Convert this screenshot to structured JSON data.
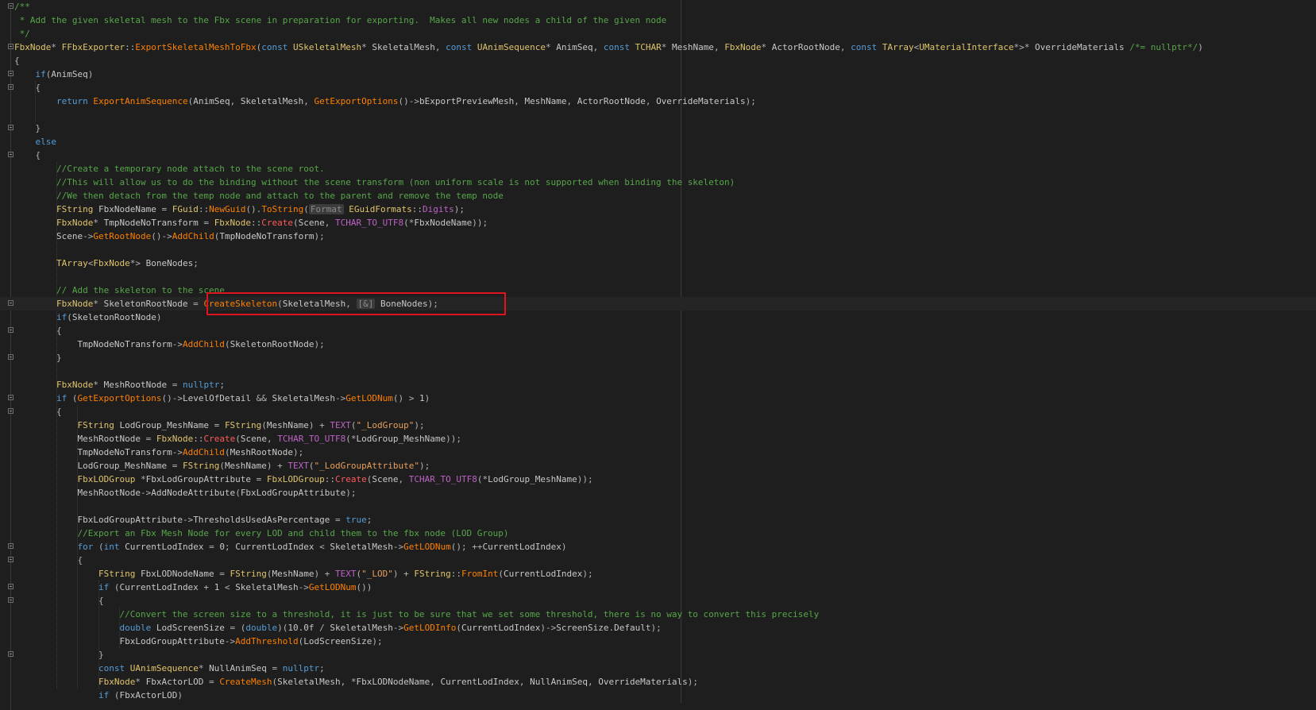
{
  "editor": {
    "lines": [
      "/**",
      " * Add the given skeletal mesh to the Fbx scene in preparation for exporting.  Makes all new nodes a child of the given node",
      " */",
      "FbxNode* FFbxExporter::ExportSkeletalMeshToFbx(const USkeletalMesh* SkeletalMesh, const UAnimSequence* AnimSeq, const TCHAR* MeshName, FbxNode* ActorRootNode, const TArray<UMaterialInterface*>* OverrideMaterials /*= nullptr*/)",
      "{",
      "    if(AnimSeq)",
      "    {",
      "        return ExportAnimSequence(AnimSeq, SkeletalMesh, GetExportOptions()->bExportPreviewMesh, MeshName, ActorRootNode, OverrideMaterials);",
      "",
      "    }",
      "    else",
      "    {",
      "        //Create a temporary node attach to the scene root.",
      "        //This will allow us to do the binding without the scene transform (non uniform scale is not supported when binding the skeleton)",
      "        //We then detach from the temp node and attach to the parent and remove the temp node",
      "        FString FbxNodeName = FGuid::NewGuid().ToString(Format EGuidFormats::Digits);",
      "        FbxNode* TmpNodeNoTransform = FbxNode::Create(Scene, TCHAR_TO_UTF8(*FbxNodeName));",
      "        Scene->GetRootNode()->AddChild(TmpNodeNoTransform);",
      "",
      "        TArray<FbxNode*> BoneNodes;",
      "",
      "        // Add the skeleton to the scene",
      "        FbxNode* SkeletonRootNode = CreateSkeleton(SkeletalMesh, [&] BoneNodes);",
      "        if(SkeletonRootNode)",
      "        {",
      "            TmpNodeNoTransform->AddChild(SkeletonRootNode);",
      "        }",
      "",
      "        FbxNode* MeshRootNode = nullptr;",
      "        if (GetExportOptions()->LevelOfDetail && SkeletalMesh->GetLODNum() > 1)",
      "        {",
      "            FString LodGroup_MeshName = FString(MeshName) + TEXT(\"_LodGroup\");",
      "            MeshRootNode = FbxNode::Create(Scene, TCHAR_TO_UTF8(*LodGroup_MeshName));",
      "            TmpNodeNoTransform->AddChild(MeshRootNode);",
      "            LodGroup_MeshName = FString(MeshName) + TEXT(\"_LodGroupAttribute\");",
      "            FbxLODGroup *FbxLodGroupAttribute = FbxLODGroup::Create(Scene, TCHAR_TO_UTF8(*LodGroup_MeshName));",
      "            MeshRootNode->AddNodeAttribute(FbxLodGroupAttribute);",
      "",
      "            FbxLodGroupAttribute->ThresholdsUsedAsPercentage = true;",
      "            //Export an Fbx Mesh Node for every LOD and child them to the fbx node (LOD Group)",
      "            for (int CurrentLodIndex = 0; CurrentLodIndex < SkeletalMesh->GetLODNum(); ++CurrentLodIndex)",
      "            {",
      "                FString FbxLODNodeName = FString(MeshName) + TEXT(\"_LOD\") + FString::FromInt(CurrentLodIndex);",
      "                if (CurrentLodIndex + 1 < SkeletalMesh->GetLODNum())",
      "                {",
      "                    //Convert the screen size to a threshold, it is just to be sure that we set some threshold, there is no way to convert this precisely",
      "                    double LodScreenSize = (double)(10.0f / SkeletalMesh->GetLODInfo(CurrentLodIndex)->ScreenSize.Default);",
      "                    FbxLodGroupAttribute->AddThreshold(LodScreenSize);",
      "                }",
      "                const UAnimSequence* NullAnimSeq = nullptr;",
      "                FbxNode* FbxActorLOD = CreateMesh(SkeletalMesh, *FbxLODNodeName, CurrentLodIndex, NullAnimSeq, OverrideMaterials);",
      "                if (FbxActorLOD)"
    ],
    "current_line": 22,
    "highlighted_expression": "CreateSkeleton(SkeletalMesh, [&] BoneNodes);",
    "highlight_color": "#e0141e",
    "background": "#1e1e1e"
  }
}
